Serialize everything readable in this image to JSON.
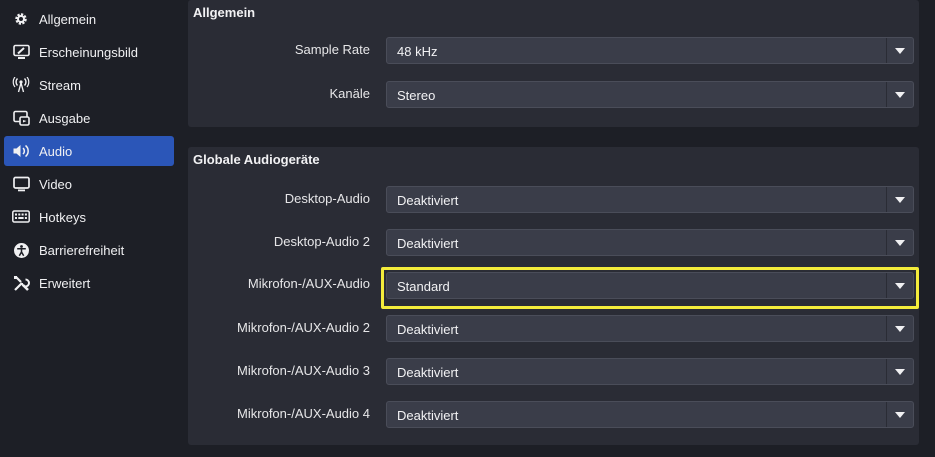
{
  "sidebar": {
    "items": [
      {
        "label": "Allgemein",
        "icon": "gear-icon"
      },
      {
        "label": "Erscheinungsbild",
        "icon": "appearance-icon"
      },
      {
        "label": "Stream",
        "icon": "antenna-icon"
      },
      {
        "label": "Ausgabe",
        "icon": "output-icon"
      },
      {
        "label": "Audio",
        "icon": "speaker-icon",
        "active": true
      },
      {
        "label": "Video",
        "icon": "monitor-icon"
      },
      {
        "label": "Hotkeys",
        "icon": "keyboard-icon"
      },
      {
        "label": "Barrierefreiheit",
        "icon": "accessibility-icon"
      },
      {
        "label": "Erweitert",
        "icon": "tools-icon"
      }
    ]
  },
  "general": {
    "title": "Allgemein",
    "sample_rate": {
      "label": "Sample Rate",
      "value": "48 kHz"
    },
    "channels": {
      "label": "Kanäle",
      "value": "Stereo"
    }
  },
  "global_audio": {
    "title": "Globale Audiogeräte",
    "devices": [
      {
        "label": "Desktop-Audio",
        "value": "Deaktiviert"
      },
      {
        "label": "Desktop-Audio 2",
        "value": "Deaktiviert"
      },
      {
        "label": "Mikrofon-/AUX-Audio",
        "value": "Standard",
        "highlighted": true
      },
      {
        "label": "Mikrofon-/AUX-Audio 2",
        "value": "Deaktiviert"
      },
      {
        "label": "Mikrofon-/AUX-Audio 3",
        "value": "Deaktiviert"
      },
      {
        "label": "Mikrofon-/AUX-Audio 4",
        "value": "Deaktiviert"
      }
    ]
  },
  "colors": {
    "accent": "#2b56b8",
    "highlight": "#f4ec3b",
    "panel": "#2a2c35",
    "field": "#3a3d49"
  }
}
